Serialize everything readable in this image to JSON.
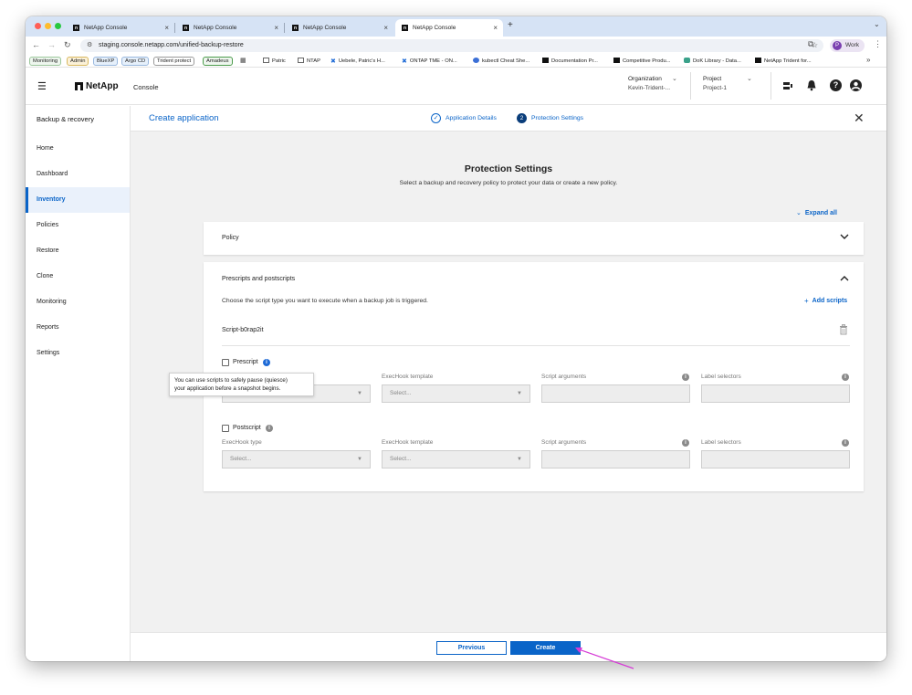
{
  "browser": {
    "tabs": [
      {
        "title": "NetApp Console",
        "active": false
      },
      {
        "title": "NetApp Console",
        "active": false
      },
      {
        "title": "NetApp Console",
        "active": false
      },
      {
        "title": "NetApp Console",
        "active": true
      }
    ],
    "new_tab_label": "+",
    "url": "staging.console.netapp.com/unified-backup-restore",
    "profile_label": "Work",
    "profile_initial": "P",
    "bookmark_chips": [
      "Monitoring",
      "Admin",
      "BlueXP",
      "Argo CD",
      "Trident protect",
      "Amadeus"
    ],
    "bookmarks": [
      "Patric",
      "NTAP",
      "Uebele, Patric's H...",
      "ONTAP TME - ON...",
      "kubectl Cheat She...",
      "Documentation Pr...",
      "Competitive Produ...",
      "DoK Library - Data...",
      "NetApp Trident for..."
    ],
    "overflow_label": "»"
  },
  "header": {
    "brand": "NetApp",
    "product": "Console",
    "organization_label": "Organization",
    "organization_value": "Kevin-Trident-...",
    "project_label": "Project",
    "project_value": "Project-1"
  },
  "sidebar": {
    "title": "Backup & recovery",
    "items": [
      {
        "label": "Home",
        "active": false
      },
      {
        "label": "Dashboard",
        "active": false
      },
      {
        "label": "Inventory",
        "active": true
      },
      {
        "label": "Policies",
        "active": false
      },
      {
        "label": "Restore",
        "active": false
      },
      {
        "label": "Clone",
        "active": false
      },
      {
        "label": "Monitoring",
        "active": false
      },
      {
        "label": "Reports",
        "active": false
      },
      {
        "label": "Settings",
        "active": false
      }
    ]
  },
  "wizard": {
    "title": "Create application",
    "steps": [
      {
        "number": "1",
        "label": "Application Details",
        "status": "complete"
      },
      {
        "number": "2",
        "label": "Protection Settings",
        "status": "current"
      }
    ]
  },
  "protection": {
    "heading": "Protection Settings",
    "subheading": "Select a backup and recovery policy to protect your data or create a new policy.",
    "expand_all": "Expand all",
    "policy_title": "Policy",
    "scripts_title": "Prescripts and postscripts",
    "scripts_description": "Choose the script type you want to execute when a backup job is triggered.",
    "add_scripts": "Add scripts",
    "script_name": "Script-b0rap2it",
    "prescript_label": "Prescript",
    "prescript_checked": false,
    "tooltip_line1": "You can use scripts to safely pause (quiesce)",
    "tooltip_line2": "your application before a snapshot begins.",
    "postscript_label": "Postscript",
    "postscript_checked": false,
    "field_exechook_type": "ExecHook type",
    "field_exechook_template": "ExecHook template",
    "field_script_arguments": "Script arguments",
    "field_label_selectors": "Label selectors",
    "select_placeholder": "Select..."
  },
  "footer": {
    "previous": "Previous",
    "create": "Create"
  },
  "colors": {
    "primary": "#0a64c8",
    "annotation_arrow": "#d63bd6"
  }
}
